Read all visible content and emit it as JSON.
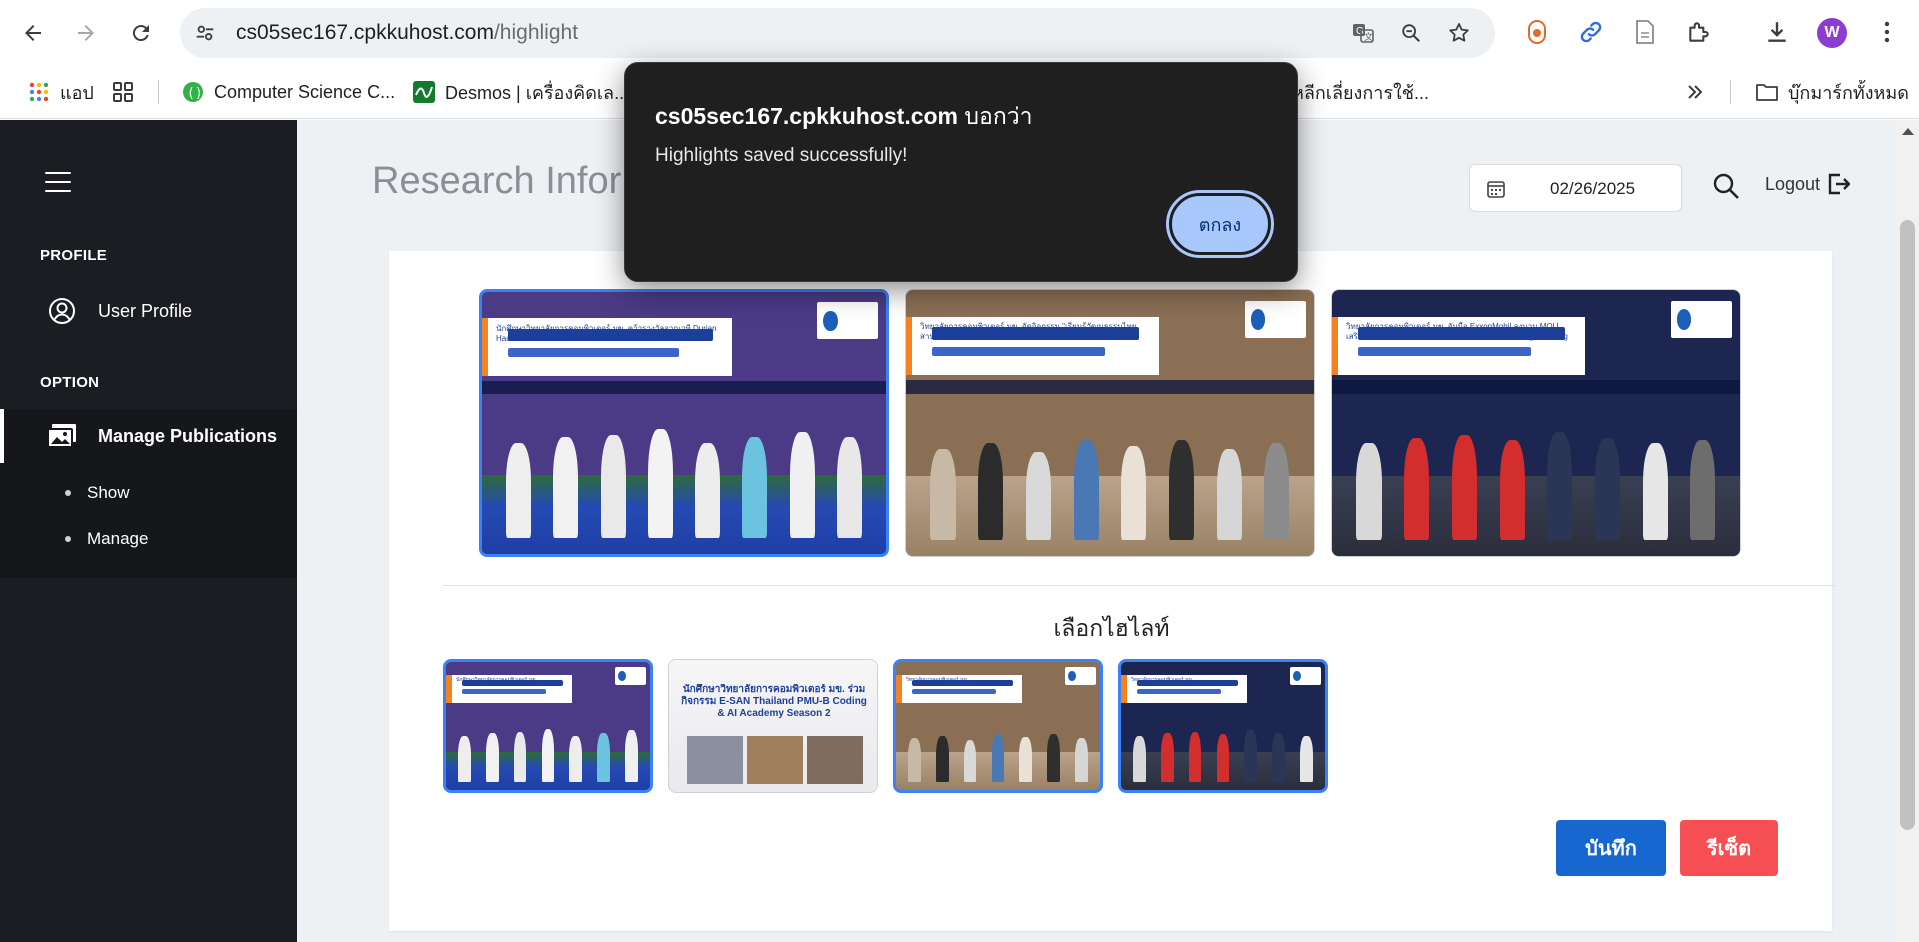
{
  "browser": {
    "url_host": "cs05sec167.cpkkuhost.com",
    "url_path": "/highlight",
    "profile_initial": "W",
    "bookmarks": [
      {
        "label": "แอป",
        "icon": "apps-grid-icon"
      },
      {
        "label": "",
        "icon": "tab-groups-icon"
      },
      {
        "label": "Computer Science C...",
        "icon": "cs-site-icon"
      },
      {
        "label": "Desmos | เครื่องคิดเล...",
        "icon": "desmos-icon"
      },
      {
        "label": ":: หลีกเลี่ยงการใช้...",
        "icon": ""
      },
      {
        "label": "บุ๊กมาร์กทั้งหมด",
        "icon": "folder-icon"
      }
    ],
    "colors": {
      "accent": "#0b57d0",
      "urlbar_bg": "#eef1f4"
    }
  },
  "sidebar": {
    "sections": [
      {
        "label": "PROFILE",
        "items": [
          {
            "label": "User Profile",
            "icon": "user-circle-icon"
          }
        ]
      },
      {
        "label": "OPTION",
        "items": [
          {
            "label": "Manage Publications",
            "icon": "images-icon",
            "active": true
          }
        ]
      }
    ],
    "sub_items": [
      {
        "label": "Show"
      },
      {
        "label": "Manage"
      }
    ],
    "colors": {
      "bg": "#1b1d22",
      "text": "#ffffff"
    }
  },
  "header": {
    "title": "Research Infor",
    "date_value": "02/26/2025",
    "logout_label": "Logout"
  },
  "highlights": {
    "selected": [
      {
        "caption": "นักศึกษาวิทยาลัยการคอมพิวเตอร์ มข. คว้ารางวัลจากเวที Durian Hackathon 2025 ด้าน AI เกษตรกรรมระดับประเทศ"
      },
      {
        "caption": "วิทยาลัยการคอมพิวเตอร์ มข. จัดกิจกรรม \"เรียนรู้วัฒนธรรมไทย สานสัมพันธ์สากล\" เสริมสร้างเครือข่ายนักศึกษาต่างชาติ"
      },
      {
        "caption": "วิทยาลัยการคอมพิวเตอร์ มข. จับมือ ExxonMobil ลงนาม MOU เสริมความร่วมมือด้านไอที พร้อมจัดกิจกรรม Knowledge Sharing"
      }
    ],
    "pick_title": "เลือกไฮไลท์",
    "options": [
      {
        "caption": "นักศึกษาวิทยาลัยการคอมพิวเตอร์ มข.",
        "selected": true
      },
      {
        "caption": "นักศึกษาวิทยาลัยการคอมพิวเตอร์ มข. ร่วมกิจกรรม E-SAN Thailand PMU-B Coding & AI Academy Season 2",
        "selected": false
      },
      {
        "caption": "วิทยาลัยการคอมพิวเตอร์ มข.",
        "selected": true
      },
      {
        "caption": "วิทยาลัยการคอมพิวเตอร์ มข.",
        "selected": true
      }
    ],
    "save_label": "บันทึก",
    "reset_label": "รีเซ็ต",
    "colors": {
      "save": "#1767d0",
      "reset": "#f54f54",
      "selected_border": "#3b82f6"
    }
  },
  "alert": {
    "host": "cs05sec167.cpkkuhost.com",
    "says": "บอกว่า",
    "message": "Highlights saved successfully!",
    "ok_label": "ตกลง"
  }
}
